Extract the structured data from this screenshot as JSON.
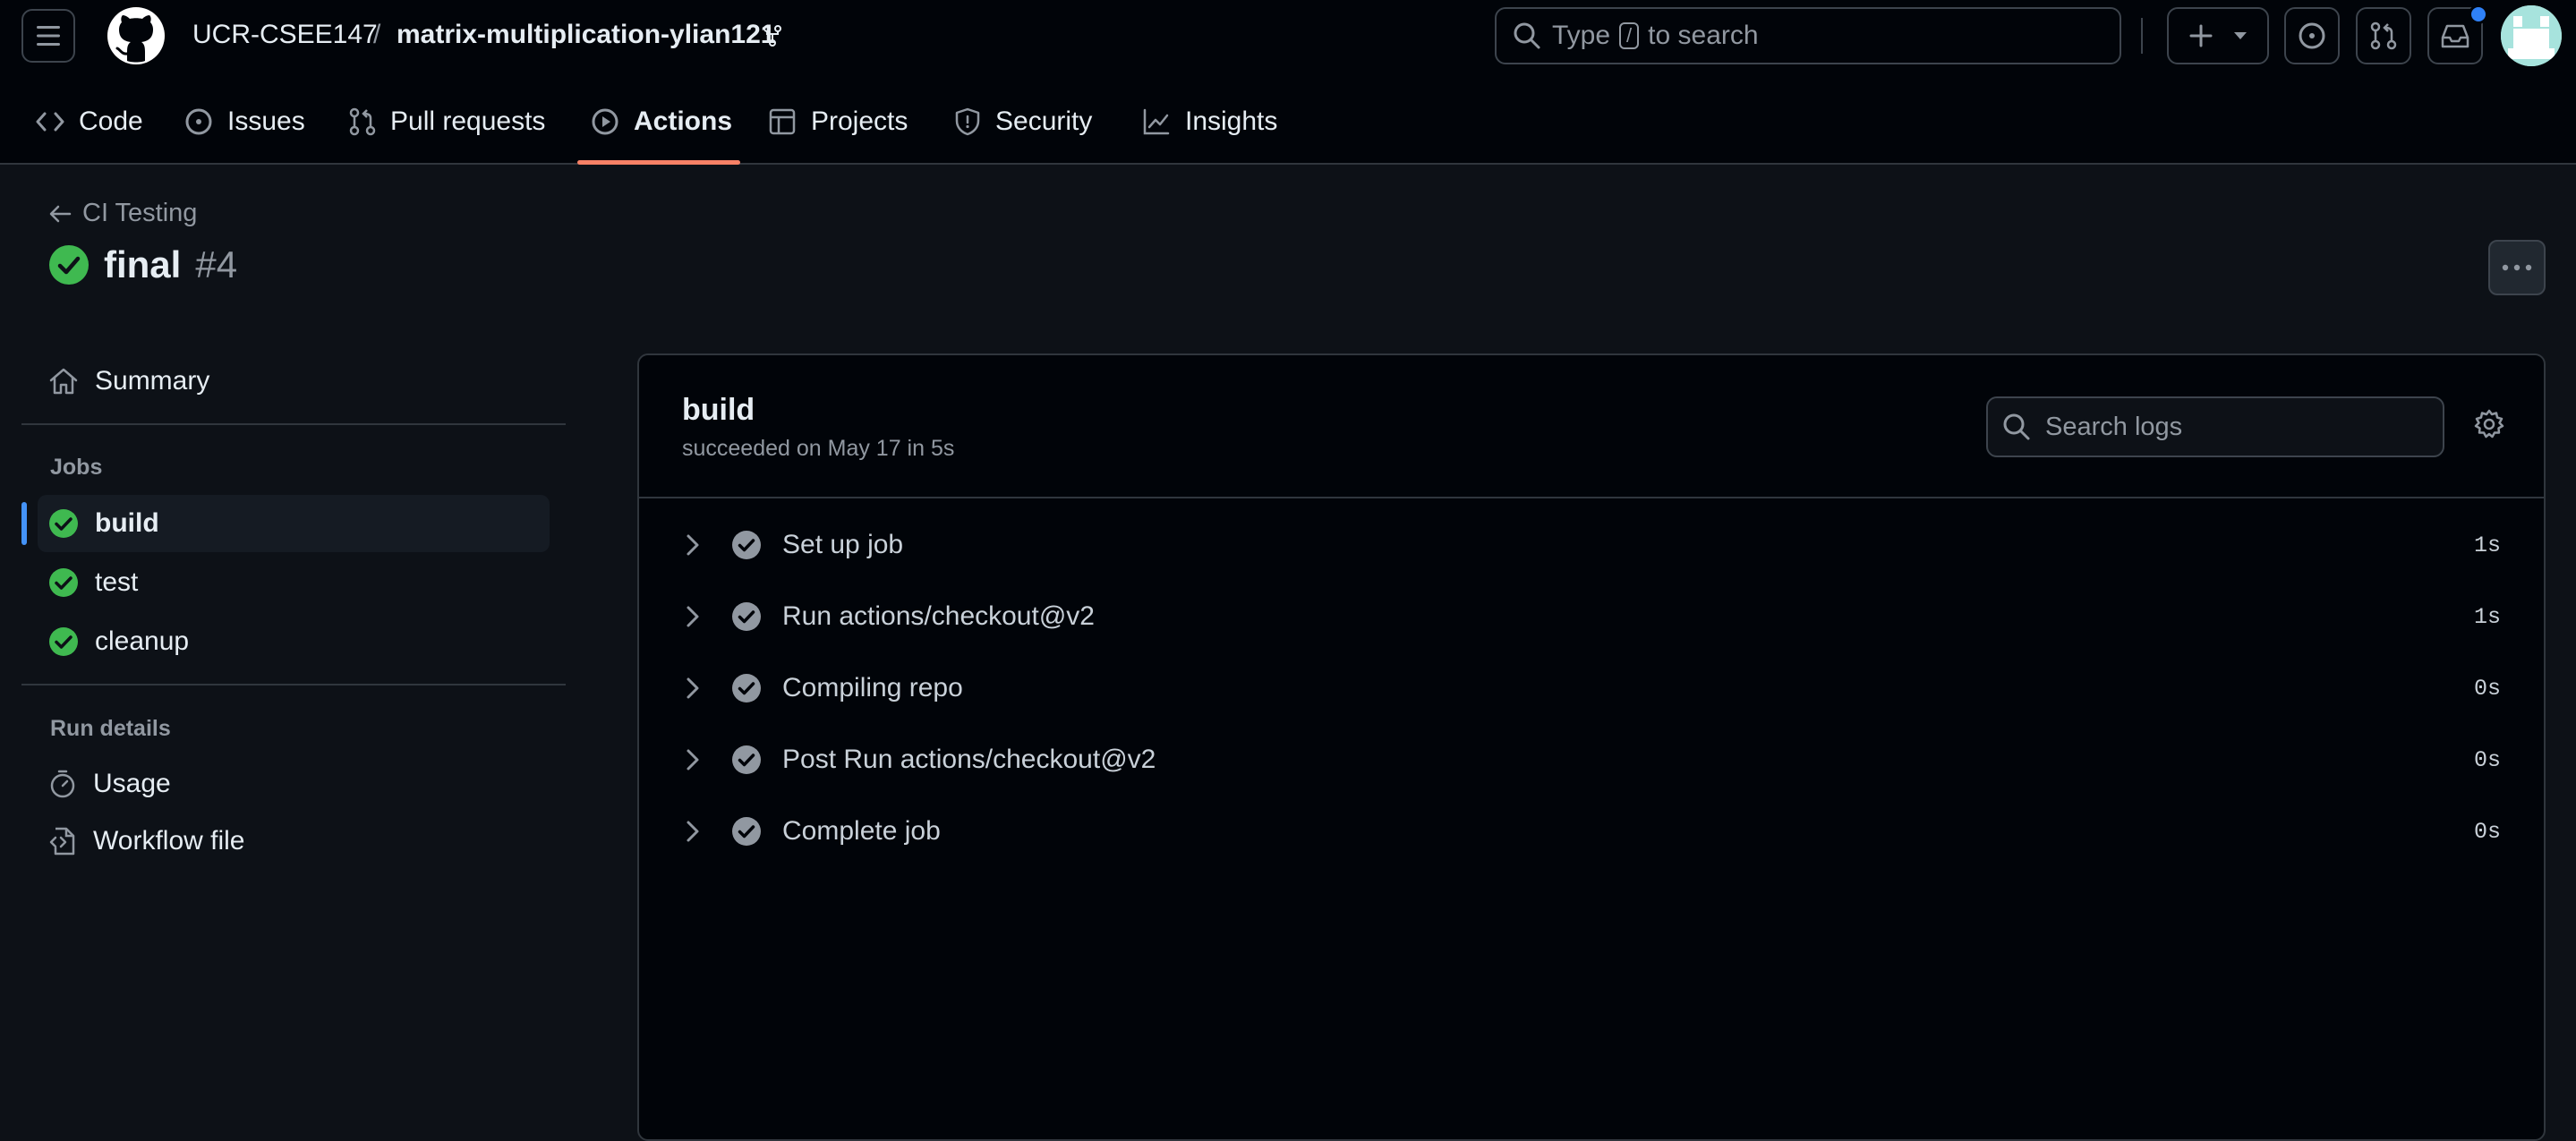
{
  "header": {
    "owner": "UCR-CSEE147",
    "separator": "/",
    "repo": "matrix-multiplication-ylian121",
    "search_placeholder_before": "Type",
    "search_key": "/",
    "search_placeholder_after": "to search"
  },
  "tabs": [
    {
      "label": "Code",
      "icon": "code-icon"
    },
    {
      "label": "Issues",
      "icon": "issue-opened-icon"
    },
    {
      "label": "Pull requests",
      "icon": "git-pull-request-icon"
    },
    {
      "label": "Actions",
      "icon": "play-icon",
      "active": true
    },
    {
      "label": "Projects",
      "icon": "table-icon"
    },
    {
      "label": "Security",
      "icon": "shield-icon"
    },
    {
      "label": "Insights",
      "icon": "graph-icon"
    }
  ],
  "run": {
    "back_label": "CI Testing",
    "title": "final",
    "number": "#4"
  },
  "sidebar": {
    "summary_label": "Summary",
    "jobs_heading": "Jobs",
    "jobs": [
      {
        "label": "build",
        "status": "success",
        "active": true
      },
      {
        "label": "test",
        "status": "success"
      },
      {
        "label": "cleanup",
        "status": "success"
      }
    ],
    "run_details_heading": "Run details",
    "usage_label": "Usage",
    "workflow_file_label": "Workflow file"
  },
  "job": {
    "name": "build",
    "status_text": "succeeded on May 17 in 5s",
    "search_placeholder": "Search logs",
    "steps": [
      {
        "name": "Set up job",
        "duration": "1s"
      },
      {
        "name": "Run actions/checkout@v2",
        "duration": "1s"
      },
      {
        "name": "Compiling repo",
        "duration": "0s"
      },
      {
        "name": "Post Run actions/checkout@v2",
        "duration": "0s"
      },
      {
        "name": "Complete job",
        "duration": "0s"
      }
    ]
  },
  "colors": {
    "background": "#0d1117",
    "header_background": "#010409",
    "success": "#3fb950",
    "active_tab_underline": "#f78166",
    "active_job_bar": "#4493f8"
  }
}
